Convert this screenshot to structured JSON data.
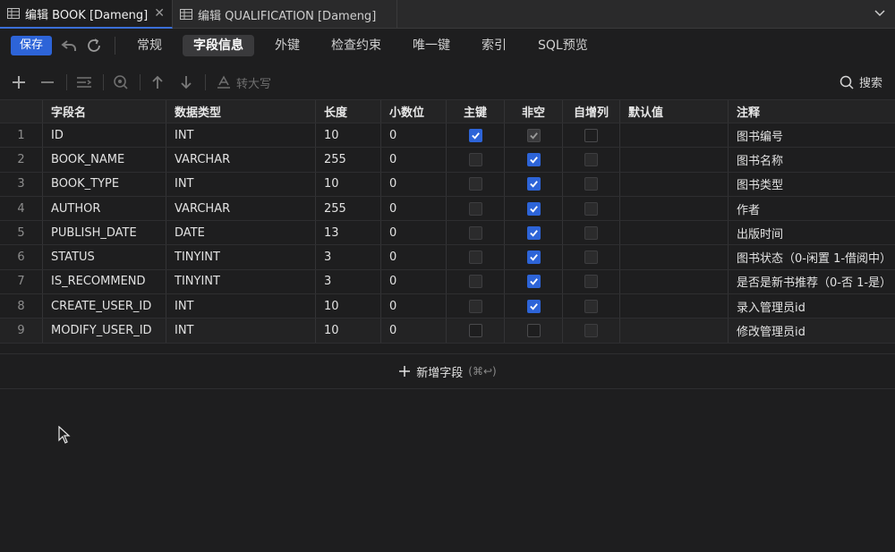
{
  "tabs": [
    {
      "label": "编辑 BOOK [Dameng]",
      "active": true
    },
    {
      "label": "编辑 QUALIFICATION [Dameng]",
      "active": false
    }
  ],
  "toolbar": {
    "save_label": "保存",
    "nav": [
      "常规",
      "字段信息",
      "外键",
      "检查约束",
      "唯一键",
      "索引",
      "SQL预览"
    ],
    "active_nav": "字段信息"
  },
  "toolbar2": {
    "uppercase_label": "转大写",
    "search_label": "搜索"
  },
  "table": {
    "headers": [
      "字段名",
      "数据类型",
      "长度",
      "小数位",
      "主键",
      "非空",
      "自增列",
      "默认值",
      "注释"
    ],
    "rows": [
      {
        "num": "1",
        "name": "ID",
        "type": "INT",
        "length": "10",
        "decimal": "0",
        "pk": true,
        "nn": true,
        "nn_locked": true,
        "ai": false,
        "default": "",
        "comment": "图书编号"
      },
      {
        "num": "2",
        "name": "BOOK_NAME",
        "type": "VARCHAR",
        "length": "255",
        "decimal": "0",
        "pk": false,
        "nn": true,
        "ai": false,
        "default": "",
        "comment": "图书名称"
      },
      {
        "num": "3",
        "name": "BOOK_TYPE",
        "type": "INT",
        "length": "10",
        "decimal": "0",
        "pk": false,
        "nn": true,
        "ai": false,
        "default": "",
        "comment": "图书类型"
      },
      {
        "num": "4",
        "name": "AUTHOR",
        "type": "VARCHAR",
        "length": "255",
        "decimal": "0",
        "pk": false,
        "nn": true,
        "ai": false,
        "default": "",
        "comment": "作者"
      },
      {
        "num": "5",
        "name": "PUBLISH_DATE",
        "type": "DATE",
        "length": "13",
        "decimal": "0",
        "pk": false,
        "nn": true,
        "ai": false,
        "default": "",
        "comment": "出版时间"
      },
      {
        "num": "6",
        "name": "STATUS",
        "type": "TINYINT",
        "length": "3",
        "decimal": "0",
        "pk": false,
        "nn": true,
        "ai": false,
        "default": "",
        "comment": "图书状态（0-闲置 1-借阅中）"
      },
      {
        "num": "7",
        "name": "IS_RECOMMEND",
        "type": "TINYINT",
        "length": "3",
        "decimal": "0",
        "pk": false,
        "nn": true,
        "ai": false,
        "default": "",
        "comment": "是否是新书推荐（0-否 1-是）"
      },
      {
        "num": "8",
        "name": "CREATE_USER_ID",
        "type": "INT",
        "length": "10",
        "decimal": "0",
        "pk": false,
        "nn": true,
        "ai": false,
        "default": "",
        "comment": "录入管理员id"
      },
      {
        "num": "9",
        "name": "MODIFY_USER_ID",
        "type": "INT",
        "length": "10",
        "decimal": "0",
        "pk": false,
        "nn": false,
        "ai": false,
        "default": "",
        "comment": "修改管理员id"
      }
    ]
  },
  "add_field": {
    "label": "新增字段",
    "hint": "(⌘↩)"
  },
  "colors": {
    "accent": "#2d64d8",
    "background": "#1e1e1f"
  }
}
